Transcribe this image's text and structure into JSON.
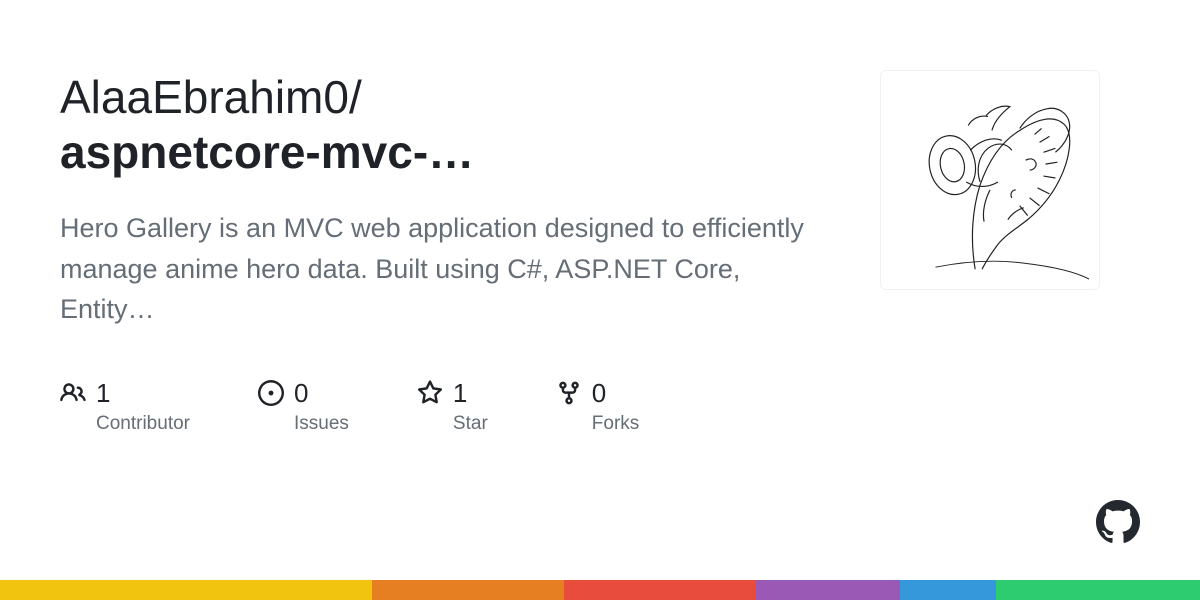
{
  "repo": {
    "owner": "AlaaEbrahim0",
    "name": "aspnetcore-mvc-…",
    "description": "Hero Gallery is an MVC web application designed to efficiently manage anime hero data. Built using C#, ASP.NET Core, Entity…"
  },
  "stats": {
    "contributors": {
      "value": "1",
      "label": "Contributor"
    },
    "issues": {
      "value": "0",
      "label": "Issues"
    },
    "stars": {
      "value": "1",
      "label": "Star"
    },
    "forks": {
      "value": "0",
      "label": "Forks"
    }
  }
}
